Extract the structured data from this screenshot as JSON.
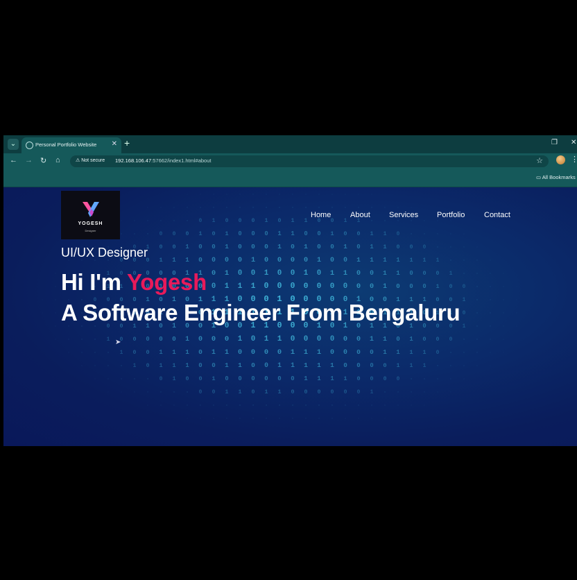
{
  "browser": {
    "tab_title": "Personal Portfolio Website",
    "security_label": "Not secure",
    "url_host": "192.168.106.47",
    "url_rest": ":57662/index1.html#about",
    "bookmarks_label": "All Bookmarks"
  },
  "site": {
    "logo_name": "YOGESH",
    "logo_tagline": "Designer",
    "nav": [
      "Home",
      "About",
      "Services",
      "Portfolio",
      "Contact"
    ],
    "subtitle": "UI/UX Designer",
    "greeting_prefix": "Hi I'm ",
    "greeting_name": "Yogesh",
    "headline": "A Software Engineer From Bengaluru"
  },
  "colors": {
    "accent": "#e81a5a",
    "chrome": "#15595a",
    "page_bg": "#0a1d5c",
    "matrix": "#47c7e8"
  },
  "icons": [
    "tab-menu-icon",
    "close-icon",
    "plus-icon",
    "back-icon",
    "forward-icon",
    "reload-icon",
    "home-icon",
    "warning-icon",
    "star-icon",
    "kebab-icon",
    "folder-icon",
    "cursor-icon"
  ]
}
